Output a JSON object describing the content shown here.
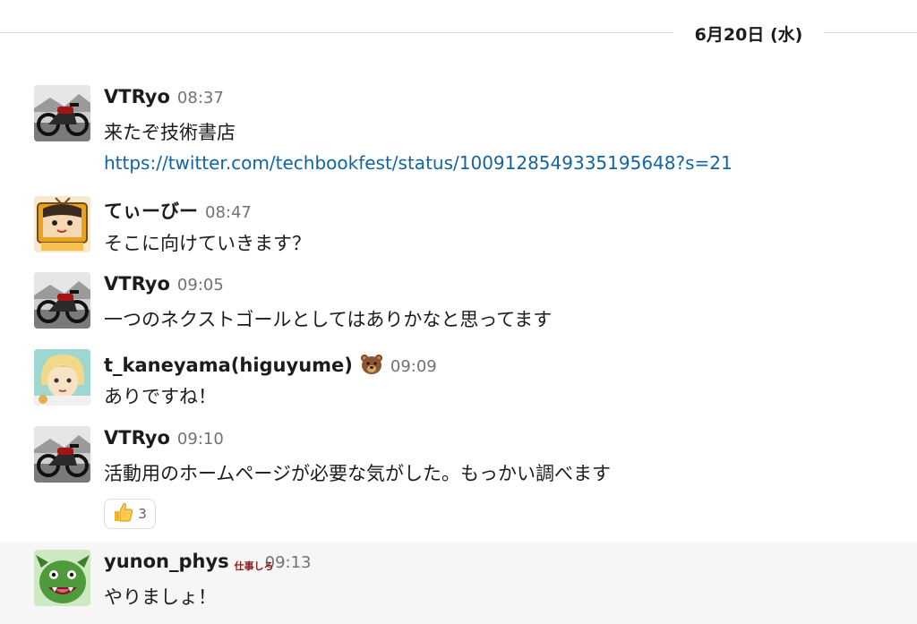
{
  "date_divider": "6月20日 (水)",
  "messages": [
    {
      "user": "VTRyo",
      "time": "08:37",
      "text": "来たぞ技術書店",
      "link": "https://twitter.com/techbookfest/status/1009128549335195648?s=21"
    },
    {
      "user": "てぃーびー",
      "time": "08:47",
      "text": "そこに向けていきます？"
    },
    {
      "user": "VTRyo",
      "time": "09:05",
      "text": "一つのネクストゴールとしてはありかなと思ってます"
    },
    {
      "user": "t_kaneyama(higuyume)",
      "status_icon": "bear-face-icon",
      "time": "09:09",
      "text": "ありですね！"
    },
    {
      "user": "VTRyo",
      "time": "09:10",
      "text": "活動用のホームページが必要な気がした。もっかい調べます",
      "reaction": {
        "icon": "thumbs-up-icon",
        "count": "3"
      }
    },
    {
      "user": "yunon_phys",
      "status_text": "仕事しろ",
      "time": "09:13",
      "text": "やりましょ！"
    }
  ],
  "colors": {
    "link": "#1264a3",
    "timestamp": "#717274",
    "highlight_bg": "#f6f6f6",
    "status_text": "#8b1a1a"
  }
}
